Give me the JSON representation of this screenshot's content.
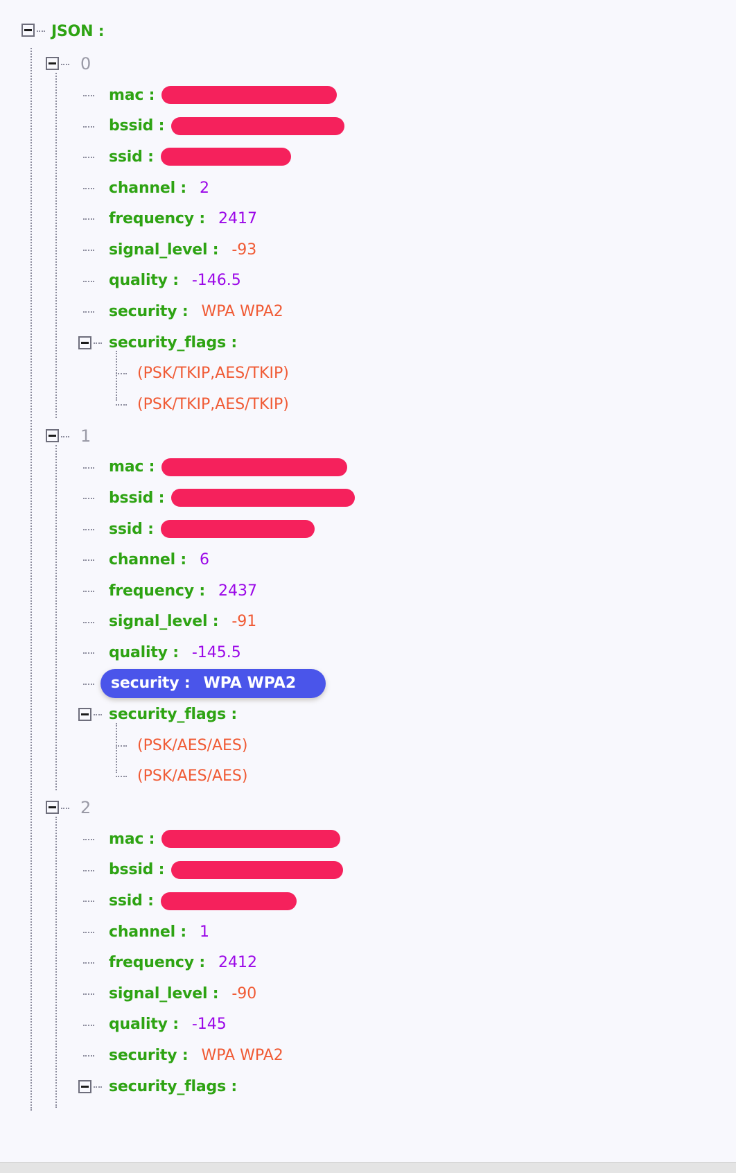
{
  "viewer": {
    "root_label": "JSON :",
    "expander_icon": "minus-box-icon",
    "background_color": "#f8f8fd",
    "key_color": "#2ea313",
    "number_color": "#9b07e8",
    "string_color": "#f05a34",
    "redaction_color": "#f5215c",
    "selection_color": "#4a55ea"
  },
  "labels": {
    "mac": "mac :",
    "bssid": "bssid :",
    "ssid": "ssid :",
    "channel": "channel :",
    "frequency": "frequency :",
    "signal_level": "signal_level :",
    "quality": "quality :",
    "security": "security :",
    "security_flags": "security_flags :"
  },
  "entries": [
    {
      "index": "0",
      "mac": "",
      "bssid": "",
      "ssid": "",
      "channel": "2",
      "frequency": "2417",
      "signal_level": "-93",
      "quality": "-146.5",
      "security": "WPA WPA2",
      "security_flags": [
        "(PSK/TKIP,AES/TKIP)",
        "(PSK/TKIP,AES/TKIP)"
      ],
      "selected": false
    },
    {
      "index": "1",
      "mac": "",
      "bssid": "",
      "ssid": "",
      "channel": "6",
      "frequency": "2437",
      "signal_level": "-91",
      "quality": "-145.5",
      "security": "WPA WPA2",
      "security_flags": [
        "(PSK/AES/AES)",
        "(PSK/AES/AES)"
      ],
      "selected": true
    },
    {
      "index": "2",
      "mac": "",
      "bssid": "",
      "ssid": "",
      "channel": "1",
      "frequency": "2412",
      "signal_level": "-90",
      "quality": "-145",
      "security": "WPA WPA2",
      "security_flags": [],
      "selected": false
    }
  ]
}
